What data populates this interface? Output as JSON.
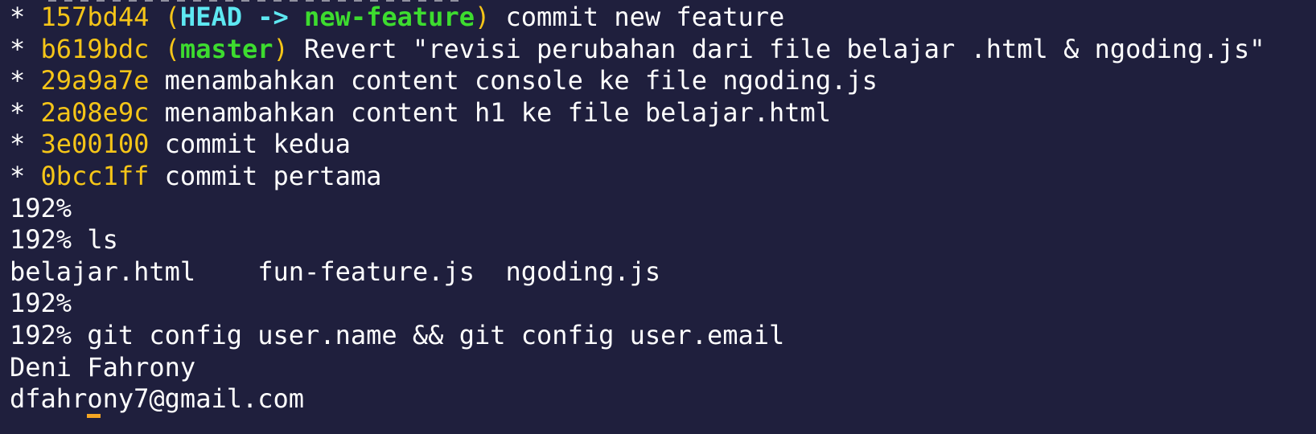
{
  "terminal": {
    "colors": {
      "background": "#1f1f3d",
      "text": "#ffffff",
      "hash": "#f5c518",
      "head": "#5ee8f2",
      "branch": "#3ddc2f",
      "cursor": "#f5a623"
    },
    "log": [
      {
        "graph": "*",
        "hash": "157bd44",
        "ref_open": "(",
        "head": "HEAD ->",
        "branch": "new-feature",
        "ref_close": ")",
        "message": "commit new feature"
      },
      {
        "graph": "*",
        "hash": "b619bdc",
        "ref_open": "(",
        "branch": "master",
        "ref_close": ")",
        "message": "Revert \"revisi perubahan dari file belajar .html & ngoding.js\""
      },
      {
        "graph": "*",
        "hash": "29a9a7e",
        "message": "menambahkan content console ke file ngoding.js"
      },
      {
        "graph": "*",
        "hash": "2a08e9c",
        "message": "menambahkan content h1 ke file belajar.html"
      },
      {
        "graph": "*",
        "hash": "3e00100",
        "message": "commit kedua"
      },
      {
        "graph": "*",
        "hash": "0bcc1ff",
        "message": "commit pertama"
      }
    ],
    "prompt": "192%",
    "commands": {
      "empty_1": "",
      "ls": "ls",
      "empty_2": "",
      "git_config": "git config user.name && git config user.email"
    },
    "ls_output": [
      "belajar.html",
      "fun-feature.js",
      "ngoding.js"
    ],
    "git_config_output": {
      "user_name": "Deni Fahrony",
      "user_email": "dfahrony7@gmail.com"
    }
  }
}
